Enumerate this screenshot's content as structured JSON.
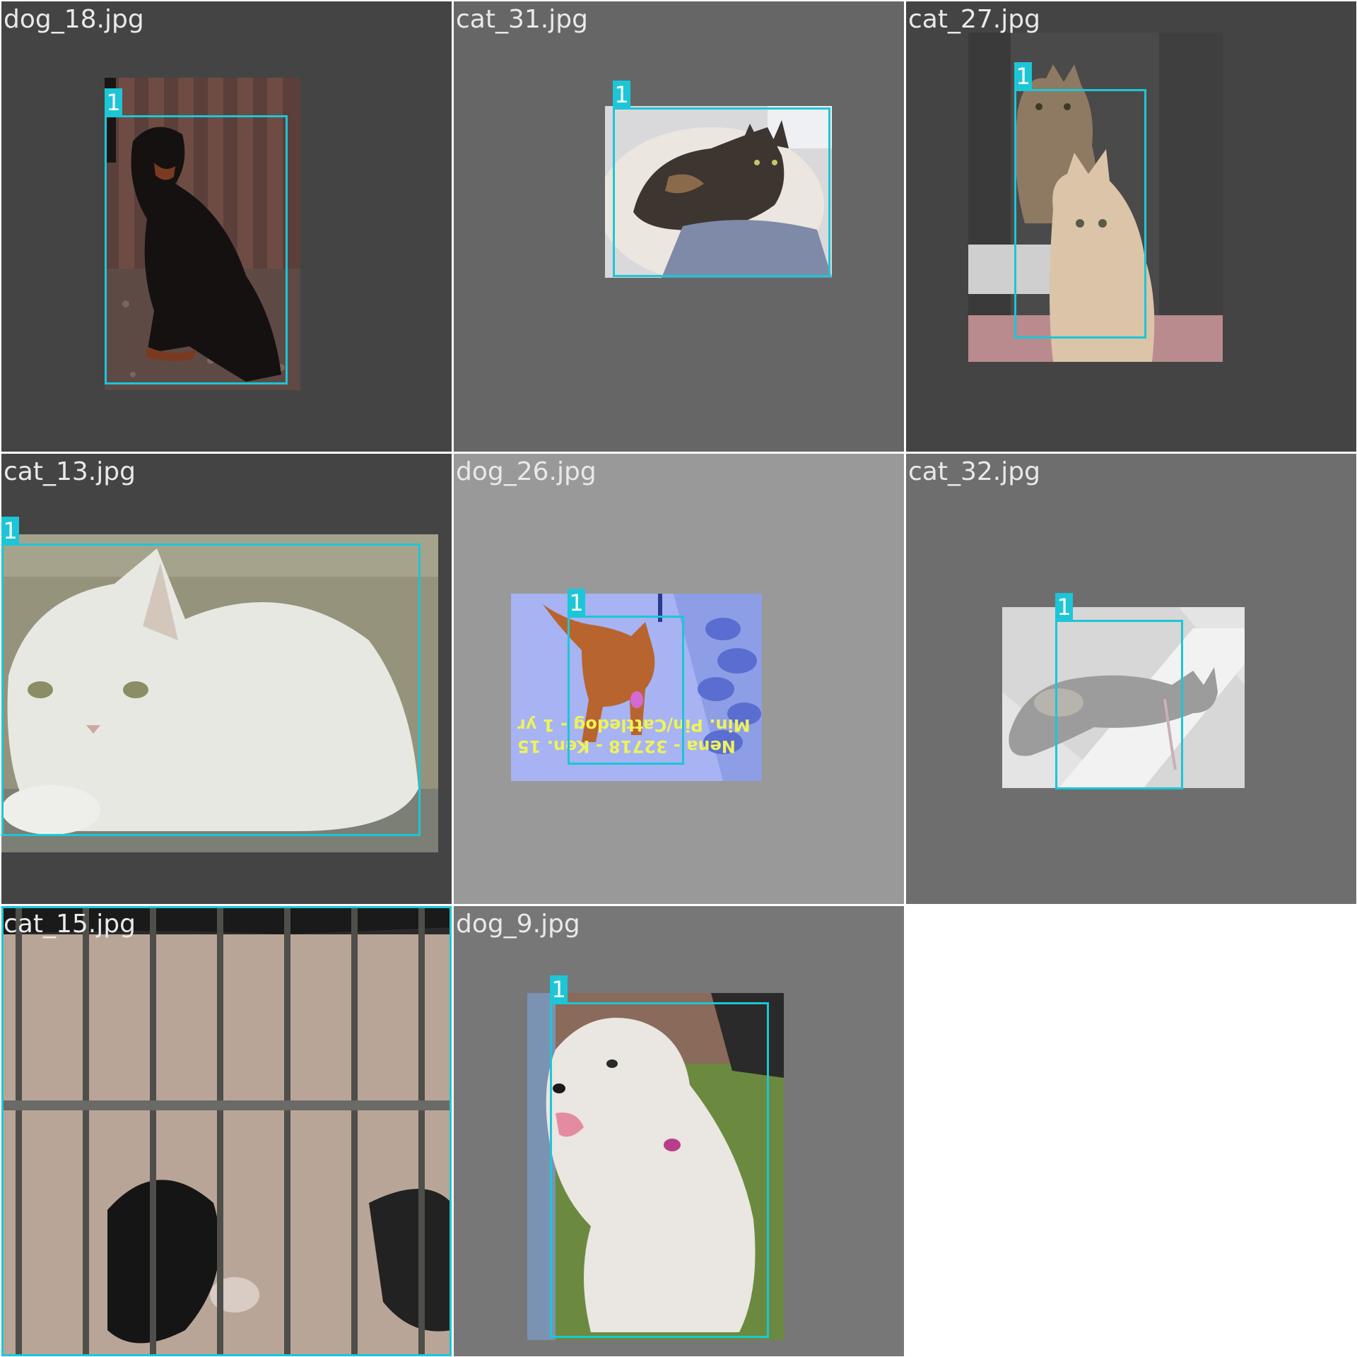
{
  "tiles": [
    {
      "filename": "dog_18.jpg",
      "class_label": "1",
      "subject": "black and tan dog sitting by wooden fence"
    },
    {
      "filename": "cat_31.jpg",
      "class_label": "1",
      "subject": "tortoiseshell cat lying in white pet bed"
    },
    {
      "filename": "cat_27.jpg",
      "class_label": "1",
      "subject": "two kittens in a cage"
    },
    {
      "filename": "cat_13.jpg",
      "class_label": "1",
      "subject": "white cat lying down"
    },
    {
      "filename": "dog_26.jpg",
      "class_label": "1",
      "subject": "red dog on leash",
      "overlay_text": [
        "Nena - 32718 - Ken. 15",
        "Min. Pin/Cattledog - 1 yr"
      ]
    },
    {
      "filename": "cat_32.jpg",
      "class_label": "1",
      "subject": "tabby cat lying on floor"
    },
    {
      "filename": "cat_15.jpg",
      "class_label": "1",
      "subject": "cream cat behind cage bars"
    },
    {
      "filename": "dog_9.jpg",
      "class_label": "1",
      "subject": "white fluffy dog on grass"
    }
  ],
  "colors": {
    "box": "#1cc6d6",
    "label_text": "#ffffff",
    "filename_text": "#e9e9e9"
  }
}
